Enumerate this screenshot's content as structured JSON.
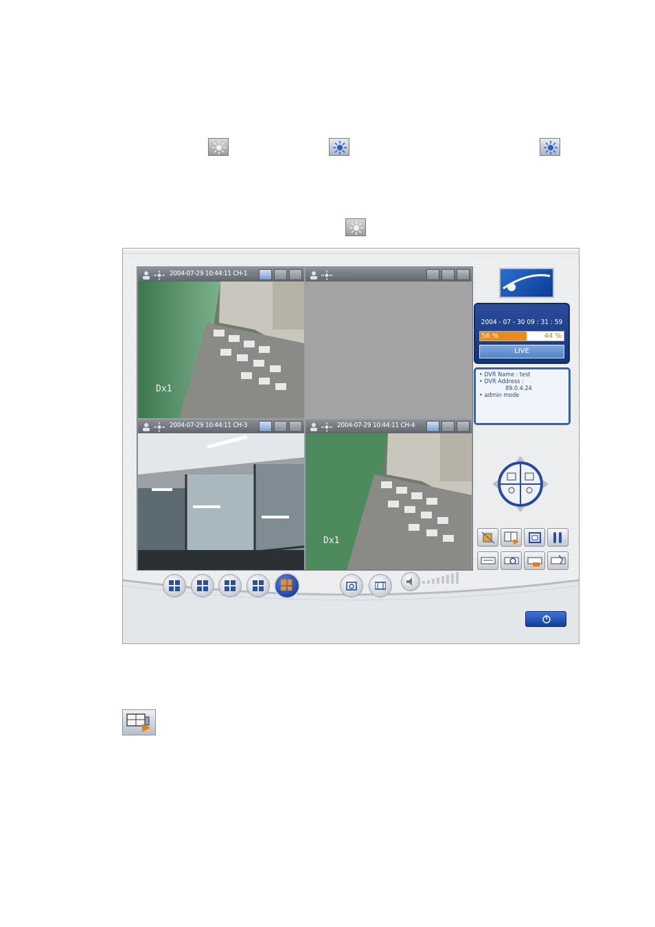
{
  "doc_icons": [
    {
      "name": "brightness-icon-1",
      "style": "grey"
    },
    {
      "name": "brightness-icon-2",
      "style": "blue"
    },
    {
      "name": "brightness-icon-3",
      "style": "blue"
    },
    {
      "name": "brightness-icon-4",
      "style": "grey"
    }
  ],
  "cameras": [
    {
      "title": "2004-07-29 10:44:11 CH-1",
      "overlay": "Dx1",
      "has_video": true,
      "brightness_active": true
    },
    {
      "title": "",
      "overlay": "",
      "has_video": false,
      "brightness_active": false
    },
    {
      "title": "2004-07-29 10:44:11 CH-3",
      "overlay": "",
      "has_video": true,
      "brightness_active": true
    },
    {
      "title": "2004-07-29 10:44:11 CH-4",
      "overlay": "Dx1",
      "has_video": true,
      "brightness_active": true
    }
  ],
  "status": {
    "datetime": "2004 - 07 - 30  09 : 31 : 59",
    "disk_used": "56 %",
    "disk_free": "44 %",
    "disk_used_fraction": 0.56,
    "mode": "LIVE"
  },
  "info": {
    "dvr_name": "• DVR Name : test",
    "dvr_address_label": "• DVR Address :",
    "dvr_address": "89.0.4.24",
    "user_mode": "• admin mode"
  },
  "colors": {
    "accent_blue": "#1b3f9c",
    "disk_used": "#ef8a18",
    "panel_border": "#3d5fa9"
  },
  "split_buttons": [
    "layout-1-icon",
    "layout-2-icon",
    "layout-3-icon",
    "layout-4-icon",
    "layout-quad-icon"
  ],
  "tool_buttons_row1": [
    "record-icon",
    "playback-icon",
    "fullscreen-icon",
    "settings-icon"
  ],
  "tool_buttons_row2": [
    "backup-icon",
    "search-icon",
    "export-icon",
    "network-icon"
  ]
}
